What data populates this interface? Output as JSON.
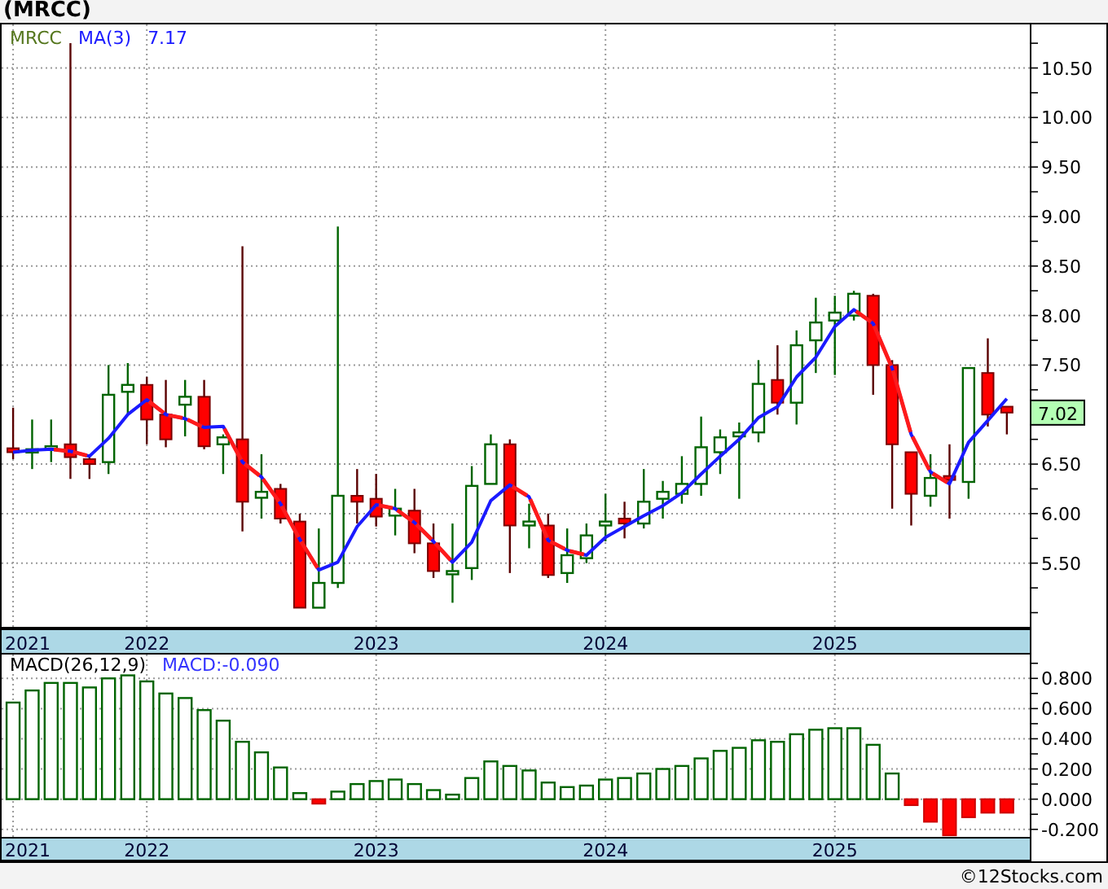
{
  "title": "(MRCC)",
  "price_panel": {
    "ma_reading": "7.17",
    "last_price": "7.02",
    "chart_data": {
      "type": "candlestick",
      "title": "MRCC",
      "grid": true,
      "xlim": [
        2021.367,
        2025.85
      ],
      "ylim": [
        4.84,
        10.94
      ],
      "x": [
        2021.417,
        2021.5,
        2021.583,
        2021.667,
        2021.75,
        2021.833,
        2021.917,
        2022,
        2022.083,
        2022.167,
        2022.25,
        2022.333,
        2022.417,
        2022.5,
        2022.583,
        2022.667,
        2022.75,
        2022.833,
        2022.917,
        2023,
        2023.083,
        2023.167,
        2023.25,
        2023.333,
        2023.417,
        2023.5,
        2023.583,
        2023.667,
        2023.75,
        2023.833,
        2023.917,
        2024,
        2024.083,
        2024.167,
        2024.25,
        2024.333,
        2024.417,
        2024.5,
        2024.583,
        2024.667,
        2024.75,
        2024.833,
        2024.917,
        2025,
        2025.083,
        2025.167,
        2025.25,
        2025.333,
        2025.417,
        2025.5,
        2025.583,
        2025.667,
        2025.75
      ],
      "xticks": [
        {
          "value": 2021.417,
          "label": "2021"
        },
        {
          "value": 2022,
          "label": "2022"
        },
        {
          "value": 2023,
          "label": "2023"
        },
        {
          "value": 2024,
          "label": "2024"
        },
        {
          "value": 2025,
          "label": "2025"
        }
      ],
      "yticks": [
        {
          "value": 5.5,
          "label": "5.50"
        },
        {
          "value": 6,
          "label": "6.00"
        },
        {
          "value": 6.5,
          "label": "6.50"
        },
        {
          "value": 7.5,
          "label": "7.50"
        },
        {
          "value": 8,
          "label": "8.00"
        },
        {
          "value": 8.5,
          "label": "8.50"
        },
        {
          "value": 9,
          "label": "9.00"
        },
        {
          "value": 9.5,
          "label": "9.50"
        },
        {
          "value": 10,
          "label": "10.00"
        },
        {
          "value": 10.5,
          "label": "10.50"
        }
      ],
      "ohlc": [
        [
          6.66,
          7.07,
          6.55,
          6.62
        ],
        [
          6.64,
          6.95,
          6.45,
          6.65
        ],
        [
          6.66,
          6.95,
          6.52,
          6.68
        ],
        [
          6.7,
          10.75,
          6.35,
          6.57
        ],
        [
          6.55,
          6.6,
          6.35,
          6.5
        ],
        [
          6.52,
          7.5,
          6.4,
          7.2
        ],
        [
          7.23,
          7.52,
          7.0,
          7.3
        ],
        [
          7.3,
          7.38,
          6.7,
          6.95
        ],
        [
          7.0,
          7.35,
          6.67,
          6.75
        ],
        [
          7.1,
          7.35,
          6.78,
          7.18
        ],
        [
          7.18,
          7.35,
          6.65,
          6.68
        ],
        [
          6.7,
          6.8,
          6.4,
          6.77
        ],
        [
          6.75,
          8.7,
          5.82,
          6.12
        ],
        [
          6.16,
          6.6,
          5.95,
          6.22
        ],
        [
          6.25,
          6.3,
          5.9,
          5.95
        ],
        [
          5.92,
          6.0,
          5.05,
          5.05
        ],
        [
          5.05,
          5.85,
          5.05,
          5.3
        ],
        [
          5.3,
          8.9,
          5.25,
          6.18
        ],
        [
          6.18,
          6.45,
          5.9,
          6.12
        ],
        [
          6.15,
          6.4,
          5.87,
          5.97
        ],
        [
          5.98,
          6.25,
          5.78,
          6.05
        ],
        [
          6.03,
          6.25,
          5.6,
          5.7
        ],
        [
          5.7,
          5.9,
          5.35,
          5.42
        ],
        [
          5.4,
          5.9,
          5.1,
          5.42
        ],
        [
          5.45,
          6.48,
          5.33,
          6.28
        ],
        [
          6.3,
          6.8,
          6.3,
          6.7
        ],
        [
          6.7,
          6.75,
          5.4,
          5.88
        ],
        [
          5.88,
          6.1,
          5.65,
          5.92
        ],
        [
          5.88,
          6.0,
          5.35,
          5.38
        ],
        [
          5.4,
          5.85,
          5.3,
          5.58
        ],
        [
          5.55,
          5.9,
          5.5,
          5.78
        ],
        [
          5.88,
          6.2,
          5.72,
          5.92
        ],
        [
          5.95,
          6.12,
          5.75,
          5.9
        ],
        [
          5.9,
          6.45,
          5.85,
          6.12
        ],
        [
          6.15,
          6.33,
          5.95,
          6.22
        ],
        [
          6.2,
          6.58,
          6.1,
          6.3
        ],
        [
          6.3,
          6.98,
          6.18,
          6.67
        ],
        [
          6.62,
          6.85,
          6.4,
          6.77
        ],
        [
          6.78,
          6.92,
          6.15,
          6.82
        ],
        [
          6.82,
          7.55,
          6.72,
          7.31
        ],
        [
          7.35,
          7.7,
          7.0,
          7.12
        ],
        [
          7.12,
          7.85,
          6.9,
          7.7
        ],
        [
          7.75,
          8.18,
          7.42,
          7.93
        ],
        [
          7.95,
          8.2,
          7.4,
          8.03
        ],
        [
          8.0,
          8.25,
          7.95,
          8.22
        ],
        [
          8.2,
          8.22,
          7.2,
          7.5
        ],
        [
          7.5,
          7.55,
          6.05,
          6.7
        ],
        [
          6.62,
          6.62,
          5.88,
          6.2
        ],
        [
          6.18,
          6.6,
          6.07,
          6.36
        ],
        [
          6.38,
          6.7,
          5.95,
          6.34
        ],
        [
          6.32,
          7.47,
          6.15,
          7.47
        ],
        [
          7.42,
          7.77,
          6.88,
          7.0
        ],
        [
          7.08,
          7.08,
          6.8,
          7.02
        ]
      ]
    },
    "moving_average": {
      "chart_data": {
        "type": "line",
        "xlim": [
          2021.367,
          2025.85
        ],
        "ylim": [
          4.84,
          10.94
        ],
        "x": [
          2021.417,
          2021.5,
          2021.583,
          2021.667,
          2021.75,
          2021.833,
          2021.917,
          2022,
          2022.083,
          2022.167,
          2022.25,
          2022.333,
          2022.417,
          2022.5,
          2022.583,
          2022.667,
          2022.75,
          2022.833,
          2022.917,
          2023,
          2023.083,
          2023.167,
          2023.25,
          2023.333,
          2023.417,
          2023.5,
          2023.583,
          2023.667,
          2023.75,
          2023.833,
          2023.917,
          2024,
          2024.083,
          2024.167,
          2024.25,
          2024.333,
          2024.417,
          2024.5,
          2024.583,
          2024.667,
          2024.75,
          2024.833,
          2024.917,
          2025,
          2025.083,
          2025.167,
          2025.25,
          2025.333,
          2025.417,
          2025.5,
          2025.583,
          2025.667,
          2025.75
        ],
        "series": [
          {
            "name": "MA(3)",
            "color": "#1a1aff",
            "values": [
              6.62,
              6.64,
              6.65,
              6.63,
              6.58,
              6.76,
              7.0,
              7.15,
              7.0,
              6.96,
              6.87,
              6.88,
              6.52,
              6.37,
              6.1,
              5.74,
              5.43,
              5.51,
              5.87,
              6.09,
              6.05,
              5.91,
              5.72,
              5.51,
              5.71,
              6.13,
              6.29,
              6.17,
              5.73,
              5.63,
              5.58,
              5.76,
              5.87,
              5.98,
              6.08,
              6.21,
              6.4,
              6.58,
              6.75,
              6.97,
              7.08,
              7.38,
              7.58,
              7.89,
              8.06,
              7.92,
              7.47,
              6.8,
              6.42,
              6.3,
              6.72,
              6.94,
              7.16
            ]
          }
        ]
      }
    }
  },
  "macd_panel": {
    "reading": "MACD:-0.090",
    "chart_data": {
      "type": "bar",
      "grid": true,
      "xlim": [
        2021.367,
        2025.85
      ],
      "ylim": [
        -0.25,
        0.958
      ],
      "x": [
        2021.417,
        2021.5,
        2021.583,
        2021.667,
        2021.75,
        2021.833,
        2021.917,
        2022,
        2022.083,
        2022.167,
        2022.25,
        2022.333,
        2022.417,
        2022.5,
        2022.583,
        2022.667,
        2022.75,
        2022.833,
        2022.917,
        2023,
        2023.083,
        2023.167,
        2023.25,
        2023.333,
        2023.417,
        2023.5,
        2023.583,
        2023.667,
        2023.75,
        2023.833,
        2023.917,
        2024,
        2024.083,
        2024.167,
        2024.25,
        2024.333,
        2024.417,
        2024.5,
        2024.583,
        2024.667,
        2024.75,
        2024.833,
        2024.917,
        2025,
        2025.083,
        2025.167,
        2025.25,
        2025.333,
        2025.417,
        2025.5,
        2025.583,
        2025.667,
        2025.75
      ],
      "xticks": [
        {
          "value": 2021.417,
          "label": "2021"
        },
        {
          "value": 2022,
          "label": "2022"
        },
        {
          "value": 2023,
          "label": "2023"
        },
        {
          "value": 2024,
          "label": "2024"
        },
        {
          "value": 2025,
          "label": "2025"
        }
      ],
      "yticks": [
        {
          "value": -0.2,
          "label": "-0.200"
        },
        {
          "value": 0,
          "label": "0.000"
        },
        {
          "value": 0.2,
          "label": "0.200"
        },
        {
          "value": 0.4,
          "label": "0.400"
        },
        {
          "value": 0.6,
          "label": "0.600"
        },
        {
          "value": 0.8,
          "label": "0.800"
        }
      ],
      "series": [
        {
          "name": "MACD(26,12,9)",
          "values": [
            0.64,
            0.72,
            0.77,
            0.77,
            0.74,
            0.8,
            0.82,
            0.78,
            0.7,
            0.67,
            0.59,
            0.52,
            0.38,
            0.31,
            0.21,
            0.04,
            -0.03,
            0.05,
            0.1,
            0.12,
            0.13,
            0.1,
            0.06,
            0.03,
            0.14,
            0.25,
            0.22,
            0.19,
            0.11,
            0.08,
            0.09,
            0.13,
            0.14,
            0.17,
            0.2,
            0.22,
            0.27,
            0.32,
            0.34,
            0.39,
            0.38,
            0.43,
            0.46,
            0.47,
            0.47,
            0.36,
            0.17,
            -0.04,
            -0.15,
            -0.24,
            -0.12,
            -0.09,
            -0.09
          ]
        }
      ]
    }
  },
  "footer": "©12Stocks.com"
}
